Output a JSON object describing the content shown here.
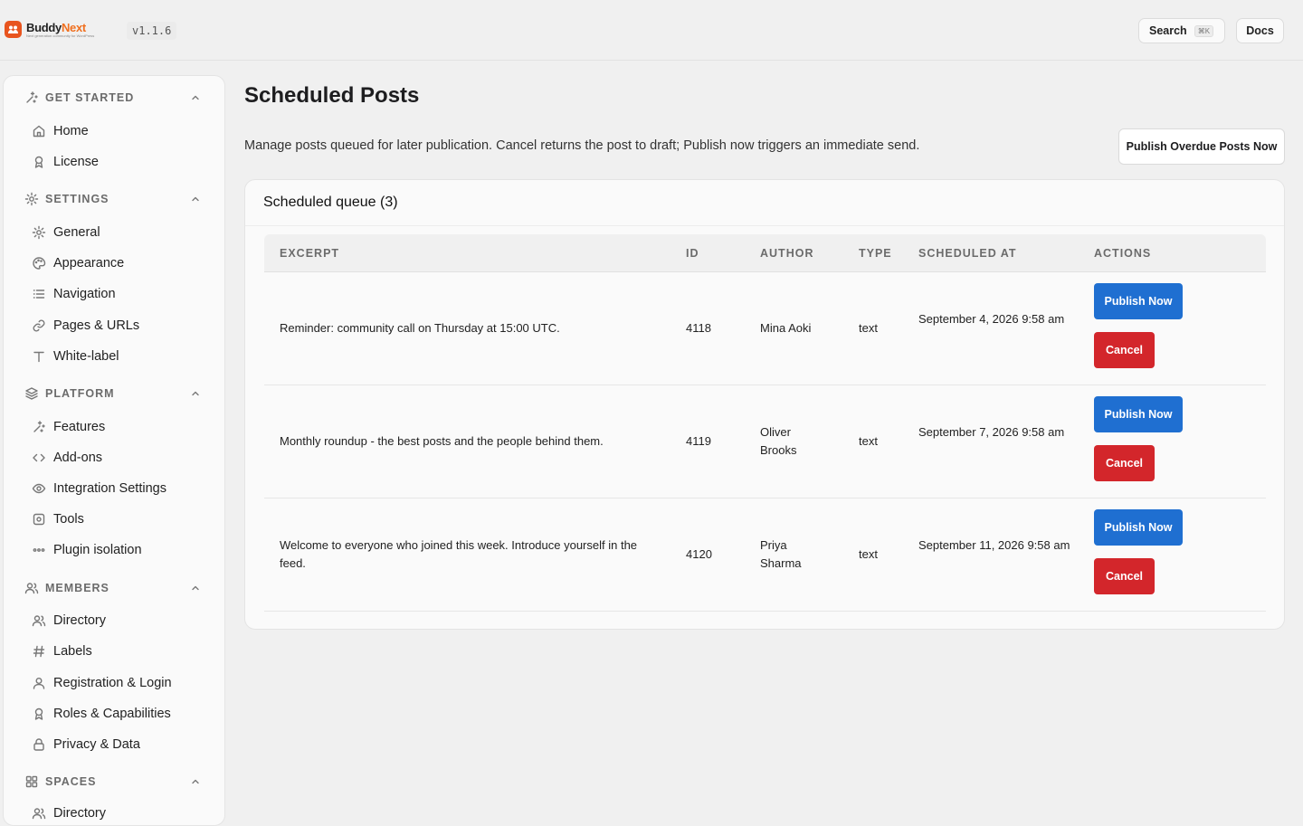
{
  "header": {
    "brand_name": "Buddy",
    "brand_name_accent": "Next",
    "brand_tagline": "Next generation community for WordPress",
    "version": "v1.1.6",
    "search_label": "Search",
    "search_shortcut": "⌘K",
    "docs_label": "Docs"
  },
  "sidebar": {
    "sections": [
      {
        "label": "GET STARTED",
        "icon": "sparkles-icon",
        "items": [
          {
            "label": "Home",
            "icon": "home-icon"
          },
          {
            "label": "License",
            "icon": "award-icon"
          }
        ]
      },
      {
        "label": "SETTINGS",
        "icon": "gear-icon",
        "items": [
          {
            "label": "General",
            "icon": "gear-icon"
          },
          {
            "label": "Appearance",
            "icon": "palette-icon"
          },
          {
            "label": "Navigation",
            "icon": "list-icon"
          },
          {
            "label": "Pages & URLs",
            "icon": "link-icon"
          },
          {
            "label": "White-label",
            "icon": "type-icon"
          }
        ]
      },
      {
        "label": "PLATFORM",
        "icon": "layers-icon",
        "items": [
          {
            "label": "Features",
            "icon": "sparkles-icon"
          },
          {
            "label": "Add-ons",
            "icon": "code-icon"
          },
          {
            "label": "Integration Settings",
            "icon": "eye-icon"
          },
          {
            "label": "Tools",
            "icon": "cog-box-icon"
          },
          {
            "label": "Plugin isolation",
            "icon": "dots-icon"
          }
        ]
      },
      {
        "label": "MEMBERS",
        "icon": "users-icon",
        "items": [
          {
            "label": "Directory",
            "icon": "users-icon"
          },
          {
            "label": "Labels",
            "icon": "hash-icon"
          },
          {
            "label": "Registration & Login",
            "icon": "user-icon"
          },
          {
            "label": "Roles & Capabilities",
            "icon": "award-icon"
          },
          {
            "label": "Privacy & Data",
            "icon": "lock-icon"
          }
        ]
      },
      {
        "label": "SPACES",
        "icon": "grid-icon",
        "items": [
          {
            "label": "Directory",
            "icon": "users-icon"
          }
        ]
      }
    ]
  },
  "main": {
    "title": "Scheduled Posts",
    "description": "Manage posts queued for later publication. Cancel returns the post to draft; Publish now triggers an immediate send.",
    "publish_overdue_label": "Publish Overdue Posts Now",
    "queue_title": "Scheduled queue (3)",
    "columns": [
      "EXCERPT",
      "ID",
      "AUTHOR",
      "TYPE",
      "SCHEDULED AT",
      "ACTIONS"
    ],
    "rows": [
      {
        "excerpt": "Reminder: community call on Thursday at 15:00 UTC.",
        "id": "4118",
        "author": "Mina Aoki",
        "type": "text",
        "scheduled_at": "September 4, 2026 9:58 am"
      },
      {
        "excerpt": "Monthly roundup - the best posts and the people behind them.",
        "id": "4119",
        "author": "Oliver Brooks",
        "type": "text",
        "scheduled_at": "September 7, 2026 9:58 am"
      },
      {
        "excerpt": "Welcome to everyone who joined this week. Introduce yourself in the feed.",
        "id": "4120",
        "author": "Priya Sharma",
        "type": "text",
        "scheduled_at": "September 11, 2026 9:58 am"
      }
    ],
    "publish_now_label": "Publish Now",
    "cancel_label": "Cancel"
  },
  "colors": {
    "brand": "#e8541e",
    "publish_button": "#1f6fd1",
    "cancel_button": "#d3262b"
  }
}
